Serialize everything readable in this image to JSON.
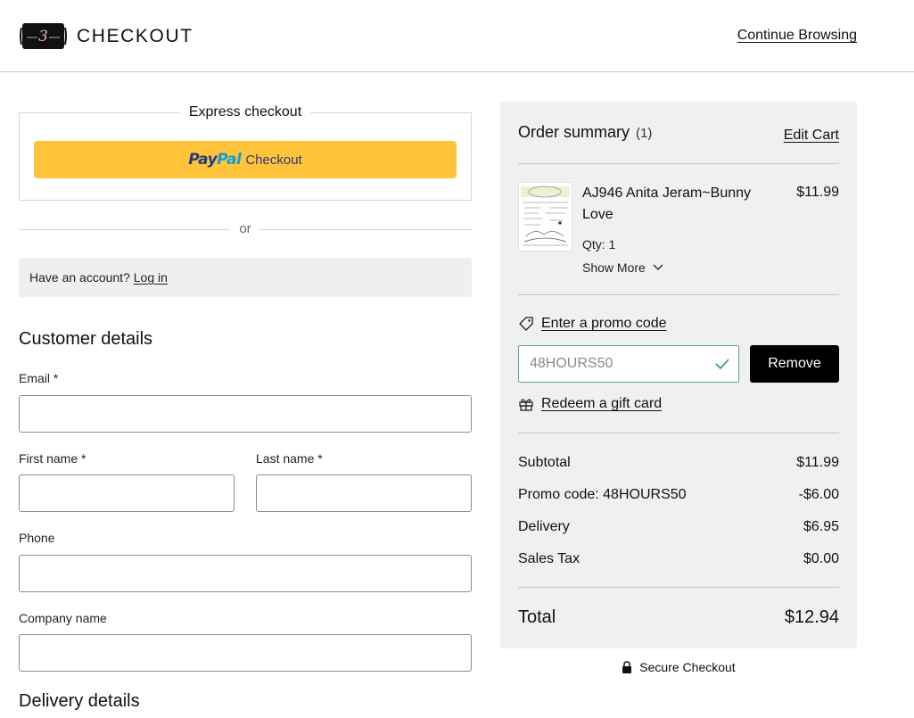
{
  "header": {
    "title": "CHECKOUT",
    "continue_label": "Continue Browsing"
  },
  "express": {
    "legend": "Express checkout",
    "paypal_pay": "Pay",
    "paypal_pal": "Pal",
    "paypal_text": "Checkout"
  },
  "divider_or": "or",
  "account": {
    "prompt": "Have an account?",
    "login_label": "Log in"
  },
  "customer": {
    "title": "Customer details",
    "email_label": "Email *",
    "first_name_label": "First name *",
    "last_name_label": "Last name *",
    "phone_label": "Phone",
    "company_label": "Company name",
    "email_value": "",
    "first_name_value": "",
    "last_name_value": "",
    "phone_value": "",
    "company_value": ""
  },
  "delivery": {
    "title": "Delivery details"
  },
  "summary": {
    "title": "Order summary",
    "count": "(1)",
    "edit_cart_label": "Edit Cart",
    "item": {
      "name": "AJ946 Anita Jeram~Bunny Love",
      "price": "$11.99",
      "qty": "Qty: 1",
      "show_more_label": "Show More"
    },
    "promo_link_label": "Enter a promo code",
    "promo_value": "48HOURS50",
    "remove_label": "Remove",
    "gift_label": "Redeem a gift card",
    "lines": [
      {
        "label": "Subtotal",
        "value": "$11.99"
      },
      {
        "label": "Promo code: 48HOURS50",
        "value": "-$6.00"
      },
      {
        "label": "Delivery",
        "value": "$6.95"
      },
      {
        "label": "Sales Tax",
        "value": "$0.00"
      }
    ],
    "total_label": "Total",
    "total_value": "$12.94"
  },
  "secure_label": "Secure Checkout",
  "colors": {
    "paypal_button": "#ffc439",
    "summary_bg": "#f0f0f0",
    "promo_valid_border": "#5fa88a",
    "remove_button": "#000000"
  },
  "icons": [
    "brand-logo",
    "tag-icon",
    "check-icon",
    "gift-icon",
    "chevron-down-icon",
    "lock-icon"
  ]
}
